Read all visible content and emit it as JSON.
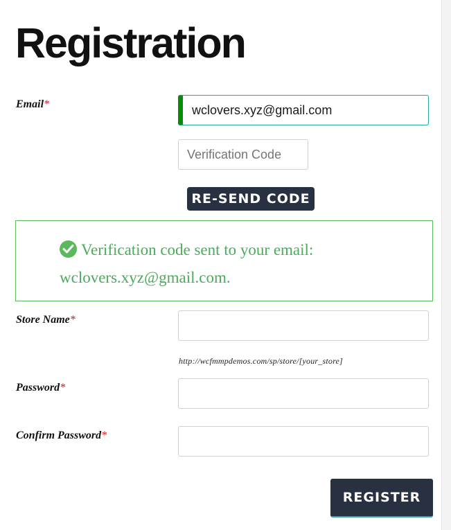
{
  "page": {
    "title": "Registration"
  },
  "form": {
    "email": {
      "label": "Email",
      "required_mark": "*",
      "value": "wclovers.xyz@gmail.com"
    },
    "verification": {
      "placeholder": "Verification Code",
      "resend_label": "RE-SEND CODE"
    },
    "notice": {
      "icon": "check-circle-icon",
      "message": "Verification code sent to your email: wclovers.xyz@gmail.com."
    },
    "store_name": {
      "label": "Store Name",
      "required_mark": "*",
      "value": "",
      "hint": "http://wcfmmpdemos.com/sp/store/[your_store]"
    },
    "password": {
      "label": "Password",
      "required_mark": "*",
      "value": ""
    },
    "confirm_password": {
      "label": "Confirm Password",
      "required_mark": "*",
      "value": ""
    },
    "submit_label": "REGISTER"
  },
  "colors": {
    "button_bg": "#273142",
    "success_green": "#5cb85c",
    "required_red": "#dd1111",
    "email_focus_bar": "#0a8a0a"
  }
}
